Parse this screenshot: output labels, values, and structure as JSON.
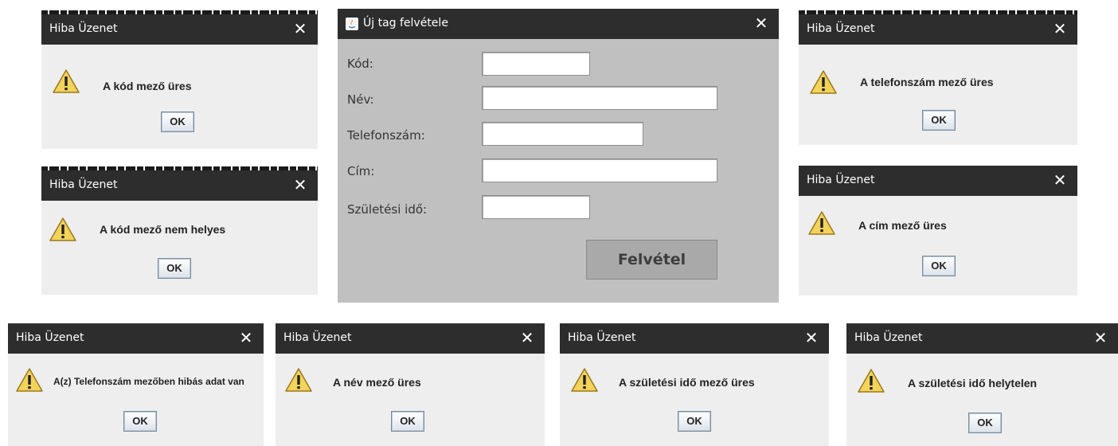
{
  "form": {
    "title": "Új tag felvétele",
    "close_glyph": "✕",
    "labels": {
      "kod": "Kód:",
      "nev": "Név:",
      "telefon": "Telefonszám:",
      "cim": "Cím:",
      "szuletesi": "Születési idő:"
    },
    "values": {
      "kod": "",
      "nev": "",
      "telefon": "",
      "cim": "",
      "szuletesi": ""
    },
    "submit_label": "Felvétel"
  },
  "dialogs": [
    {
      "title": "Hiba Üzenet",
      "message": "A kód mező üres",
      "ok": "OK"
    },
    {
      "title": "Hiba Üzenet",
      "message": "A kód mező nem helyes",
      "ok": "OK"
    },
    {
      "title": "Hiba Üzenet",
      "message": "A telefonszám mező üres",
      "ok": "OK"
    },
    {
      "title": "Hiba Üzenet",
      "message": "A cím mező üres",
      "ok": "OK"
    },
    {
      "title": "Hiba Üzenet",
      "message": "A(z) Telefonszám mezőben hibás adat van",
      "ok": "OK"
    },
    {
      "title": "Hiba Üzenet",
      "message": "A név mező üres",
      "ok": "OK"
    },
    {
      "title": "Hiba Üzenet",
      "message": "A születési idő mező üres",
      "ok": "OK"
    },
    {
      "title": "Hiba Üzenet",
      "message": "A születési idő helytelen",
      "ok": "OK"
    }
  ],
  "icons": {
    "warning": "warning-icon",
    "close": "close-icon",
    "app": "java-app-icon"
  },
  "colors": {
    "titlebar": "#2d2d2d",
    "dialog_bg": "#eeeeee",
    "form_bg": "#c0c0c0",
    "button_bg": "#a9a9a9"
  }
}
